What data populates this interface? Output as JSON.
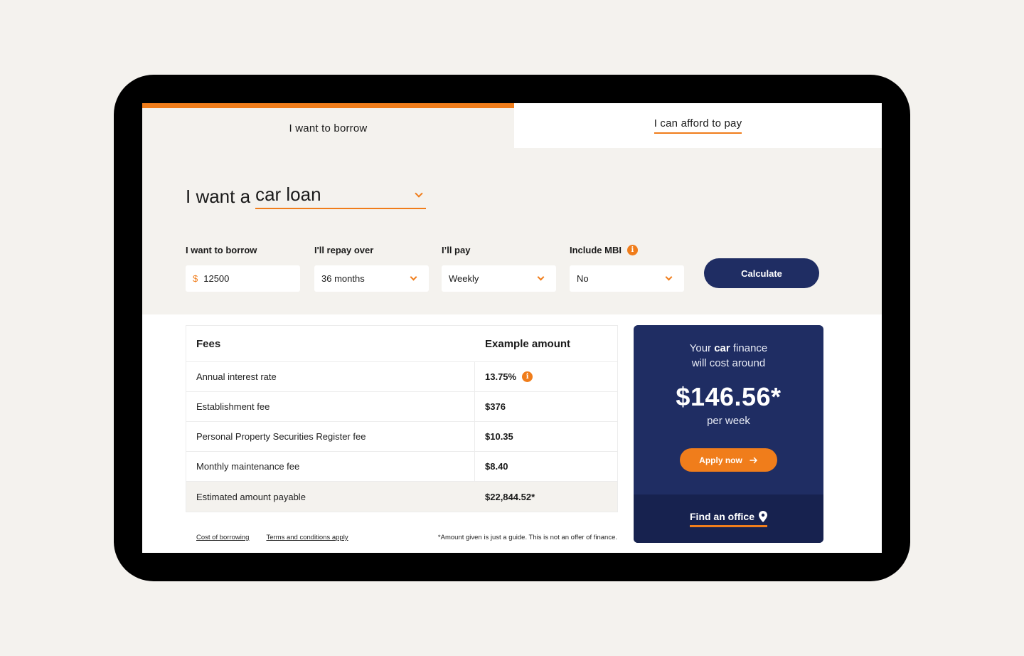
{
  "tabs": [
    {
      "label": "I want to borrow",
      "active": true
    },
    {
      "label": "I can afford to pay",
      "active": false
    }
  ],
  "loan": {
    "prefix": "I want a",
    "type": "car loan"
  },
  "fields": {
    "borrow": {
      "label": "I want to borrow",
      "currency": "$",
      "value": "12500"
    },
    "repay": {
      "label": "I'll repay over",
      "value": "36 months"
    },
    "pay": {
      "label": "I’ll pay",
      "value": "Weekly"
    },
    "mbi": {
      "label": "Include MBI",
      "value": "No"
    }
  },
  "calculate_label": "Calculate",
  "fees": {
    "header": {
      "name": "Fees",
      "value": "Example amount"
    },
    "rows": [
      {
        "name": "Annual interest rate",
        "value": "13.75%"
      },
      {
        "name": "Establishment fee",
        "value": "$376"
      },
      {
        "name": "Personal Property Securities Register fee",
        "value": "$10.35"
      },
      {
        "name": "Monthly maintenance fee",
        "value": "$8.40"
      }
    ],
    "total": {
      "name": "Estimated amount payable",
      "value": "$22,844.52*"
    }
  },
  "footer": {
    "cost_link": "Cost of borrowing",
    "terms_link": "Terms and conditions apply",
    "disclaimer": "*Amount given is just a guide. This is not an offer of finance."
  },
  "result": {
    "line1_pre": "Your",
    "line1_bold": "car",
    "line1_post": "finance",
    "line2": "will cost around",
    "amount": "$146.56*",
    "period": "per week",
    "apply_label": "Apply now",
    "office_label": "Find an office"
  },
  "icons": {
    "info": "info-icon",
    "chevron": "chevron-down-icon",
    "arrow": "arrow-right-icon",
    "pin": "location-pin-icon"
  },
  "colors": {
    "accent": "#f07d1b",
    "navy": "#1f2d63",
    "navy_dark": "#17224f",
    "beige": "#f4f2ee"
  }
}
